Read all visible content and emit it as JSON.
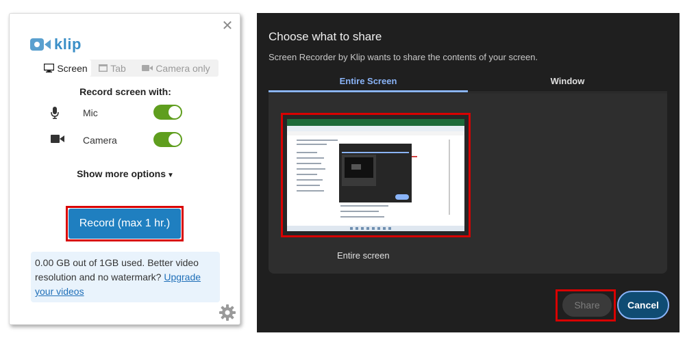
{
  "klip": {
    "brand": "klip",
    "close_icon": "close-icon",
    "tabs": [
      {
        "label": "Screen",
        "icon": "monitor-icon",
        "active": true
      },
      {
        "label": "Tab",
        "icon": "browser-tab-icon",
        "active": false
      },
      {
        "label": "Camera only",
        "icon": "video-camera-icon",
        "active": false
      }
    ],
    "record_heading": "Record screen with:",
    "options": [
      {
        "label": "Mic",
        "icon": "microphone-icon",
        "enabled": true
      },
      {
        "label": "Camera",
        "icon": "video-camera-icon",
        "enabled": true
      }
    ],
    "more_options": "Show more options",
    "record_button": "Record (max 1 hr.)",
    "usage_text": "0.00 GB out of 1GB used. Better video resolution and no watermark? ",
    "upgrade_link": "Upgrade your videos",
    "settings_icon": "gear-icon"
  },
  "share_dialog": {
    "title": "Choose what to share",
    "description": "Screen Recorder by Klip wants to share the contents of your screen.",
    "tabs": [
      {
        "label": "Entire Screen",
        "active": true
      },
      {
        "label": "Window",
        "active": false
      }
    ],
    "screen_label": "Entire screen",
    "share_button": "Share",
    "cancel_button": "Cancel"
  },
  "colors": {
    "klip_blue": "#1f7fc0",
    "toggle_green": "#5f9e1e",
    "highlight_red": "#d90000",
    "dialog_bg": "#1f1f1f",
    "tab_accent": "#8ab4f8"
  }
}
